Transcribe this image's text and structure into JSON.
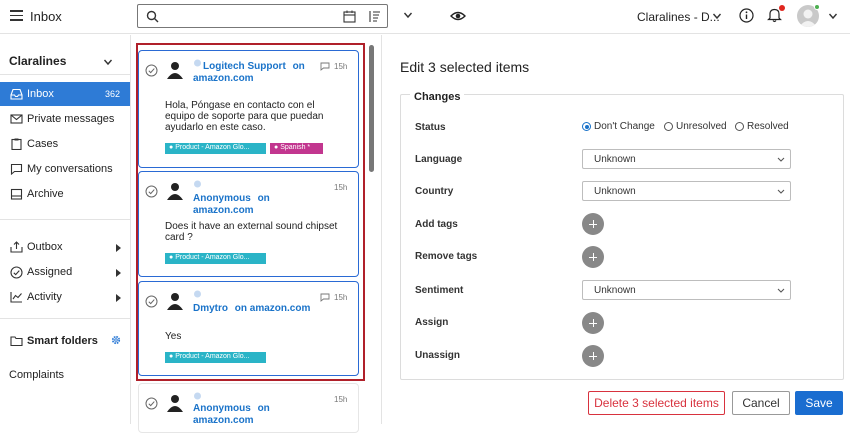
{
  "header": {
    "title": "Inbox",
    "account": "Claralines - D..."
  },
  "sidebar": {
    "account": "Claralines",
    "items": [
      {
        "label": "Inbox",
        "count": "362"
      },
      {
        "label": "Private messages"
      },
      {
        "label": "Cases"
      },
      {
        "label": "My conversations"
      },
      {
        "label": "Archive"
      },
      {
        "label": "Outbox"
      },
      {
        "label": "Assigned"
      },
      {
        "label": "Activity"
      }
    ],
    "smart_folders": "Smart folders",
    "complaints": "Complaints"
  },
  "messages": [
    {
      "author": "Logitech Support",
      "source": "on amazon.com",
      "time": "15h",
      "text": "Hola, Póngase en contacto con el equipo de soporte para que puedan ayudarlo en este caso.",
      "tags": [
        "Product - Amazon Glo...",
        "Spanish *"
      ]
    },
    {
      "author": "Anonymous",
      "source": "on amazon.com",
      "time": "15h",
      "text": "Does it have an external sound chipset card ?",
      "tags": [
        "Product - Amazon Glo..."
      ]
    },
    {
      "author": "Dmytro",
      "source": "on amazon.com",
      "time": "15h",
      "text": "Yes",
      "tags": [
        "Product - Amazon Glo..."
      ]
    },
    {
      "author": "Anonymous",
      "source": "on amazon.com",
      "time": "15h"
    }
  ],
  "edit": {
    "title": "Edit 3 selected items",
    "changes_label": "Changes",
    "status_label": "Status",
    "status_options": [
      "Don't Change",
      "Unresolved",
      "Resolved"
    ],
    "status_selected": "Don't Change",
    "language_label": "Language",
    "language_value": "Unknown",
    "country_label": "Country",
    "country_value": "Unknown",
    "add_tags_label": "Add tags",
    "remove_tags_label": "Remove tags",
    "sentiment_label": "Sentiment",
    "sentiment_value": "Unknown",
    "assign_label": "Assign",
    "unassign_label": "Unassign",
    "delete_button": "Delete 3 selected items",
    "cancel_button": "Cancel",
    "save_button": "Save"
  },
  "colors": {
    "accent": "#2e7bd6",
    "link": "#1a73c9",
    "selection_frame": "#b0202a",
    "tag_teal": "#2ab4c7",
    "tag_pink": "#c2368f",
    "danger": "#d8323e"
  }
}
